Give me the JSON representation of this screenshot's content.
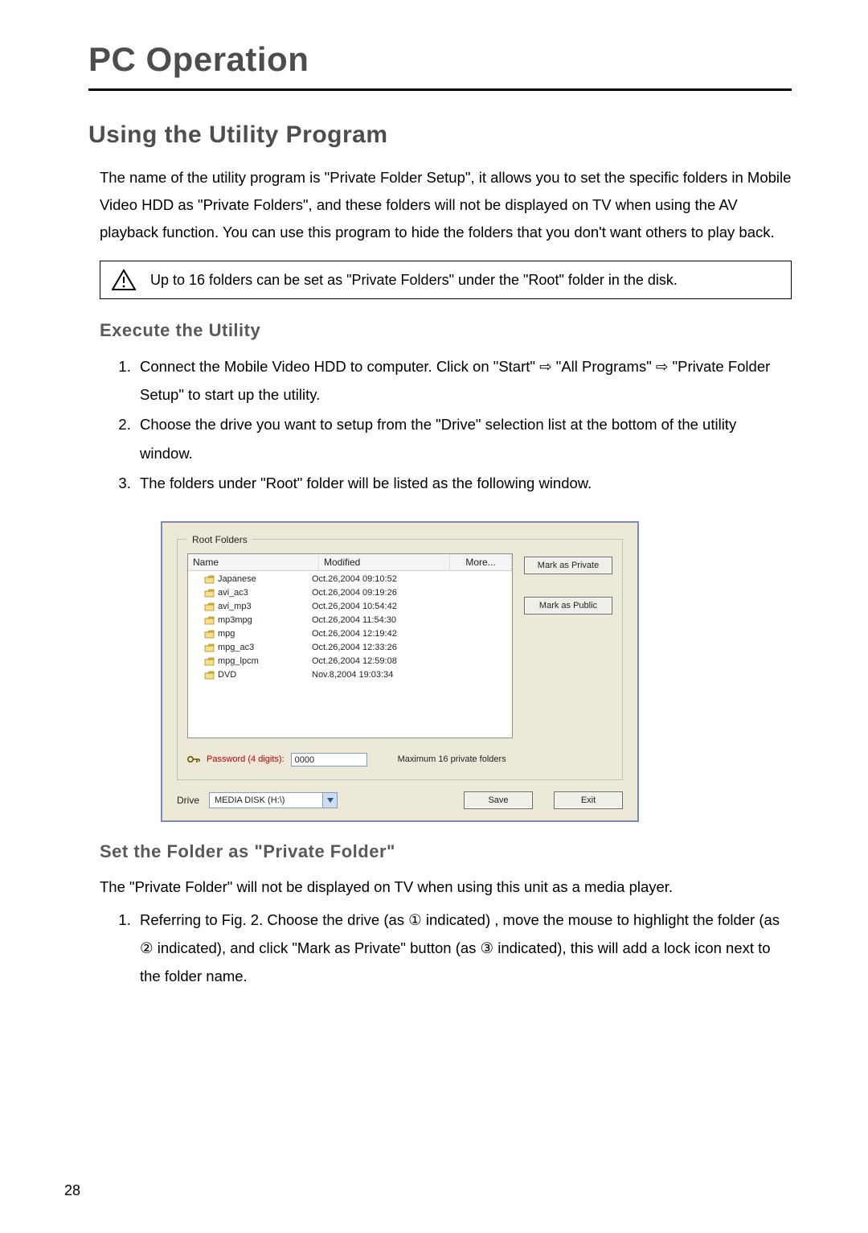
{
  "page": {
    "number": "28",
    "title": "PC Operation"
  },
  "section": {
    "title": "Using the Utility Program",
    "intro": "The name of the utility program is \"Private Folder Setup\", it allows you to set the specific folders in Mobile Video HDD as \"Private Folders\", and these folders will not be displayed on TV when using the AV playback function. You can use this program to hide the folders that you don't want others to play back.",
    "notice": "Up to 16 folders can be set as \"Private Folders\" under the \"Root\" folder in the disk."
  },
  "exec": {
    "heading": "Execute the Utility",
    "steps": [
      "Connect the Mobile Video HDD to computer. Click on \"Start\" ⇨ \"All Programs\" ⇨ \"Private Folder Setup\" to start up the utility.",
      "Choose the drive you want to setup from the \"Drive\" selection list at the bottom of the utility window.",
      "The folders under \"Root\" folder will be listed as the following window."
    ]
  },
  "util": {
    "legend": "Root Folders",
    "columns": {
      "name": "Name",
      "modified": "Modified",
      "more": "More..."
    },
    "rows": [
      {
        "name": "Japanese",
        "modified": "Oct.26,2004 09:10:52"
      },
      {
        "name": "avi_ac3",
        "modified": "Oct.26,2004 09:19:26"
      },
      {
        "name": "avi_mp3",
        "modified": "Oct.26,2004 10:54:42"
      },
      {
        "name": "mp3mpg",
        "modified": "Oct.26,2004 11:54:30"
      },
      {
        "name": "mpg",
        "modified": "Oct.26,2004 12:19:42"
      },
      {
        "name": "mpg_ac3",
        "modified": "Oct.26,2004 12:33:26"
      },
      {
        "name": "mpg_lpcm",
        "modified": "Oct.26,2004 12:59:08"
      },
      {
        "name": "DVD",
        "modified": "Nov.8,2004 19:03:34"
      }
    ],
    "password_label": "Password (4 digits):",
    "password_value": "0000",
    "max_label": "Maximum 16 private folders",
    "drive_label": "Drive",
    "drive_value": "MEDIA DISK (H:\\)",
    "buttons": {
      "mark_private": "Mark as Private",
      "mark_public": "Mark as Public",
      "save": "Save",
      "exit": "Exit"
    }
  },
  "set_private": {
    "heading": "Set the Folder as \"Private Folder\"",
    "para": "The \"Private Folder\" will not be displayed on TV when using this unit as a media player.",
    "step1": "Referring to Fig. 2. Choose the drive (as ① indicated) , move the mouse to highlight the folder (as ② indicated), and click \"Mark as Private\" button (as ③ indicated), this will add a lock icon next to the folder name."
  }
}
